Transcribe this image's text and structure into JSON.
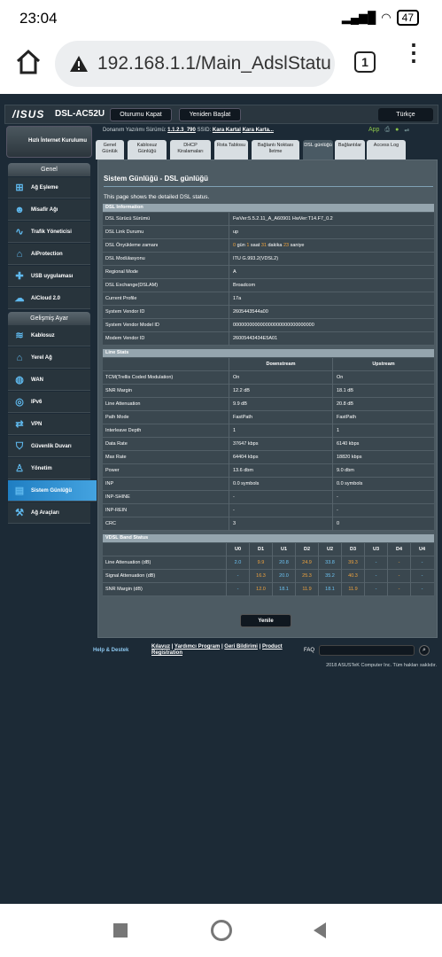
{
  "status": {
    "time": "23:04",
    "battery": "47"
  },
  "browser": {
    "url": "192.168.1.1/Main_AdslStatu",
    "tab_count": "1"
  },
  "router": {
    "logo": "/ISUS",
    "model": "DSL-AC52U",
    "logout": "Oturumu Kapat",
    "reboot": "Yeniden Başlat",
    "language": "Türkçe",
    "fw_label": "Donanım Yazılımı Sürümü:",
    "fw_version": "1.1.2.3_790",
    "ssid_label": "SSID:",
    "ssid1": "Kara Kartal",
    "ssid2": "Kara Karta...",
    "app_label": "App",
    "quick": "Hızlı İnternet Kurulumu",
    "general": "Genel",
    "advanced": "Gelişmiş Ayar",
    "nav_general": [
      {
        "label": "Ağ Eşleme",
        "icon": "network-map-icon"
      },
      {
        "label": "Misafir Ağı",
        "icon": "guest-network-icon"
      },
      {
        "label": "Trafik Yöneticisi",
        "icon": "traffic-manager-icon"
      },
      {
        "label": "AiProtection",
        "icon": "aiprotection-icon"
      },
      {
        "label": "USB uygulaması",
        "icon": "usb-app-icon"
      },
      {
        "label": "AiCloud 2.0",
        "icon": "aicloud-icon"
      }
    ],
    "nav_advanced": [
      {
        "label": "Kablosuz",
        "icon": "wireless-icon"
      },
      {
        "label": "Yerel Ağ",
        "icon": "lan-icon"
      },
      {
        "label": "WAN",
        "icon": "wan-icon"
      },
      {
        "label": "IPv6",
        "icon": "ipv6-icon"
      },
      {
        "label": "VPN",
        "icon": "vpn-icon"
      },
      {
        "label": "Güvenlik Duvarı",
        "icon": "firewall-icon"
      },
      {
        "label": "Yönetim",
        "icon": "administration-icon"
      },
      {
        "label": "Sistem Günlüğü",
        "icon": "system-log-icon"
      },
      {
        "label": "Ağ Araçları",
        "icon": "network-tools-icon"
      }
    ],
    "tabs": [
      "Genel Günlük",
      "Kablosuz Günlüğü",
      "DHCP Kiralamaları",
      "Rota Tablosu",
      "Bağlantı Noktası İletme",
      "DSL günlüğü",
      "Bağlantılar",
      "Access Log"
    ],
    "page_title": "Sistem Günlüğü - DSL günlüğü",
    "page_desc": "This page shows the detailed DSL status.",
    "dsl_info_title": "DSL Information",
    "dsl_info": [
      {
        "k": "DSL Sürücü Sürümü",
        "v": "FwVer:5.5.2.11_A_A60901 HwVer:T14.F7_0.2"
      },
      {
        "k": "DSL Link Durumu",
        "v": "up"
      },
      {
        "k": "DSL Önyükleme zamanı",
        "v": "0 gün 1 saat 31 dakika 23 saniye"
      },
      {
        "k": "DSL Modülasyonu",
        "v": "ITU G.993.2(VDSL2)"
      },
      {
        "k": "Regional Mode",
        "v": "A"
      },
      {
        "k": "DSL Exchange(DSLAM)",
        "v": "Broadcom"
      },
      {
        "k": "Current Profile",
        "v": "17a"
      },
      {
        "k": "System Vendor ID",
        "v": "2605443544a00"
      },
      {
        "k": "System Vendor Model ID",
        "v": "000000000000000000000000000000"
      },
      {
        "k": "Modem Vendor ID",
        "v": "26005443434E5A01"
      }
    ],
    "line_stats_title": "Line Stats",
    "downstream": "Downstream",
    "upstream": "Upstream",
    "line_stats": [
      {
        "k": "TCM(Trellis Coded Modulation)",
        "d": "On",
        "u": "On"
      },
      {
        "k": "SNR Margin",
        "d": "12.2 dB",
        "u": "18.1 dB"
      },
      {
        "k": "Line Attenuation",
        "d": "9.9 dB",
        "u": "20.8 dB"
      },
      {
        "k": "Path Mode",
        "d": "FastPath",
        "u": "FastPath"
      },
      {
        "k": "Interleave Depth",
        "d": "1",
        "u": "1"
      },
      {
        "k": "Data Rate",
        "d": "37647 kbps",
        "u": "6140 kbps"
      },
      {
        "k": "Max Rate",
        "d": "64404 kbps",
        "u": "18820 kbps"
      },
      {
        "k": "Power",
        "d": "13.6 dbm",
        "u": "9.0 dbm"
      },
      {
        "k": "INP",
        "d": "0.0 symbols",
        "u": "0.0 symbols"
      },
      {
        "k": "INP-SHINE",
        "d": "-",
        "u": "-"
      },
      {
        "k": "INP-REIN",
        "d": "-",
        "u": "-"
      },
      {
        "k": "CRC",
        "d": "3",
        "u": "0"
      }
    ],
    "vdsl_title": "VDSL Band Status",
    "bands": [
      "U0",
      "D1",
      "U1",
      "D2",
      "U2",
      "D3",
      "U3",
      "D4",
      "U4"
    ],
    "band_rows": [
      {
        "k": "Line Attenuation (dB)",
        "v": [
          "2.0",
          "9.9",
          "20.8",
          "24.9",
          "33.8",
          "39.3",
          "-",
          "-",
          "-"
        ]
      },
      {
        "k": "Signal Attenuation (dB)",
        "v": [
          "-",
          "16.3",
          "20.0",
          "25.3",
          "35.2",
          "40.3",
          "-",
          "-",
          "-"
        ]
      },
      {
        "k": "SNR Margin (dB)",
        "v": [
          "-",
          "12.0",
          "18.1",
          "11.9",
          "18.1",
          "11.9",
          "-",
          "-",
          "-"
        ]
      }
    ],
    "refresh": "Yenile",
    "help": "Help & Destek",
    "link1": "Kılavuz",
    "link2": "Yardımcı Program",
    "link3": "Geri Bildirimi",
    "link4": "Product Registration",
    "faq": "FAQ",
    "copyright": "2018 ASUSTeK Computer Inc. Tüm hakları saklıdır."
  }
}
